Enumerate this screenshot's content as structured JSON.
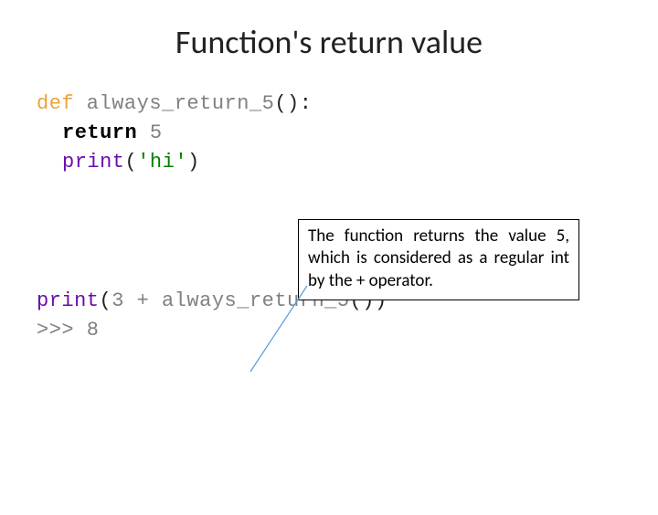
{
  "title": "Function's return value",
  "code": {
    "l1_def": "def",
    "l1_name": " always_return_5",
    "l1_paren": "():",
    "l2_return": "return",
    "l2_val": " 5",
    "l3_print": "print",
    "l3_open": "(",
    "l3_str": "'hi'",
    "l3_close": ")",
    "l4_print": "print",
    "l4_open": "(",
    "l4_expr1": "3 + always_return_5",
    "l4_expr2": "())",
    "l5": ">>> 8"
  },
  "callout": "The function returns the value 5, which is considered as a regular int by the + operator."
}
